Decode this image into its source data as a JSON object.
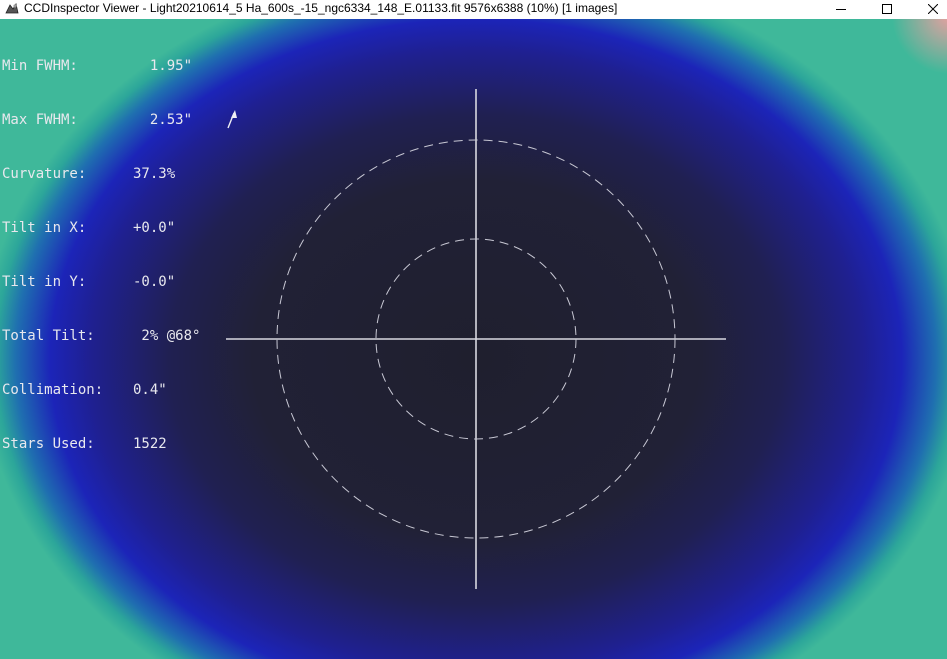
{
  "window": {
    "title": "CCDInspector Viewer - Light20210614_5 Ha_600s_-15_ngc6334_148_E.01133.fit 9576x6388 (10%)  [1 images]"
  },
  "icons": {
    "app": "ccdinspector-app-icon",
    "minimize": "minimize-icon",
    "maximize": "maximize-icon",
    "close": "close-icon",
    "arrow": "tilt-direction-arrow-icon"
  },
  "stats": {
    "min_fwhm": {
      "label": "Min FWHM:",
      "value": "  1.95\""
    },
    "max_fwhm": {
      "label": "Max FWHM:",
      "value": "  2.53\""
    },
    "curvature": {
      "label": "Curvature:",
      "value": "37.3%"
    },
    "tilt_x": {
      "label": "Tilt in X:",
      "value": "+0.0\""
    },
    "tilt_y": {
      "label": "Tilt in Y:",
      "value": "-0.0\""
    },
    "total_tilt": {
      "label": "Total Tilt:",
      "value": " 2% @68°"
    },
    "collimation": {
      "label": "Collimation:",
      "value": "0.4\""
    },
    "stars_used": {
      "label": "Stars Used:",
      "value": "1522"
    }
  },
  "tilt_angle_deg": 68,
  "colors": {
    "center": "#1f1f2e",
    "mid_blue": "#1f2090",
    "edge_teal": "#2ca69a",
    "corner_pink": "#e8a0a0",
    "overlay_lines": "#d8d8e0"
  }
}
